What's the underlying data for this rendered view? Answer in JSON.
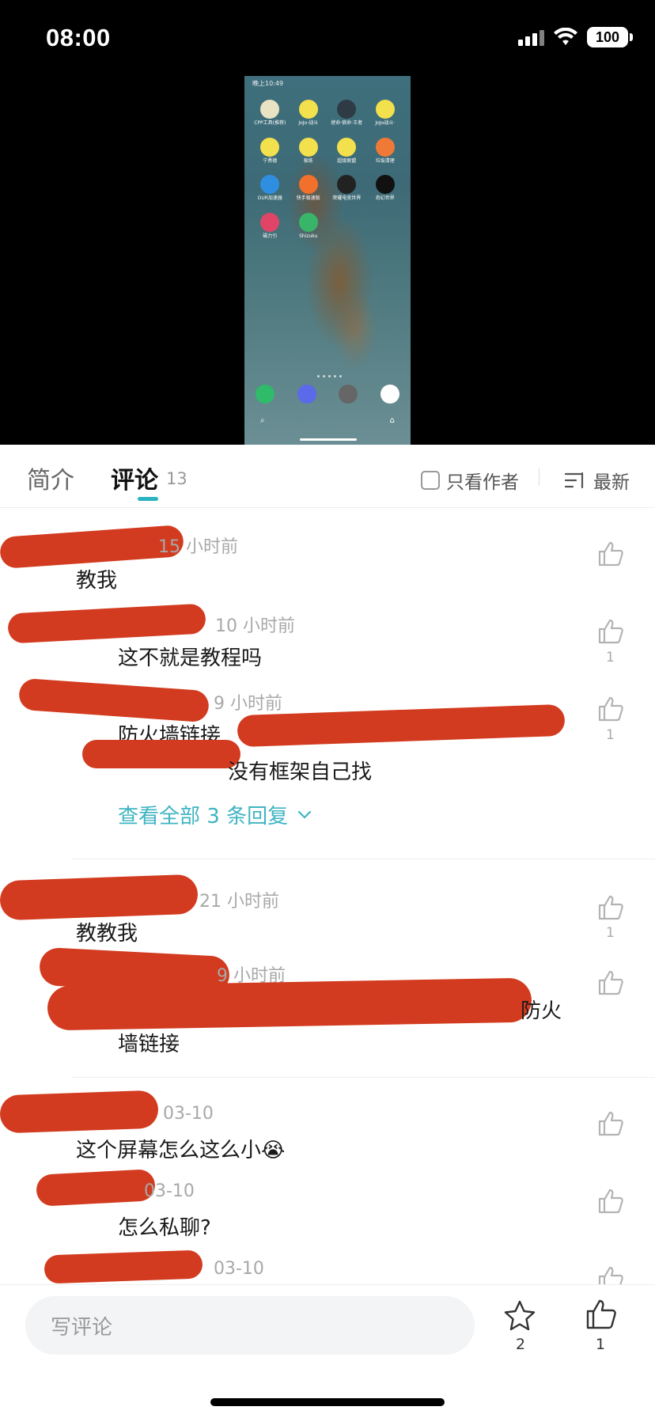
{
  "status_bar": {
    "time": "08:00",
    "battery": "100"
  },
  "video": {
    "status_text": "晚上10:49",
    "apps": [
      {
        "label": "CPP工具(推荐)",
        "color": "#e9e3c4"
      },
      {
        "label": "JoJo·战斗",
        "color": "#f3e04d"
      },
      {
        "label": "使命·宿命·王者",
        "color": "#2e3b45"
      },
      {
        "label": "JoJo战斗·",
        "color": "#f3e04d"
      },
      {
        "label": "宁勇德",
        "color": "#f3e04d"
      },
      {
        "label": "极练",
        "color": "#f3e04d"
      },
      {
        "label": "超级联盟",
        "color": "#f3e04d"
      },
      {
        "label": "垃圾清理",
        "color": "#ef7a37"
      },
      {
        "label": "OUR加速器",
        "color": "#2f8ee0"
      },
      {
        "label": "快手极速版",
        "color": "#f0702c"
      },
      {
        "label": "荣耀电竞世界",
        "color": "#222"
      },
      {
        "label": "奇幻世界",
        "color": "#111"
      },
      {
        "label": "磁力引",
        "color": "#e04567"
      },
      {
        "label": "Shizuku",
        "color": "#39b56a"
      }
    ],
    "dock_colors": [
      "#2fbb6a",
      "#5a6ae8",
      "#666",
      "#ffffff"
    ]
  },
  "tabs": {
    "intro": "简介",
    "comments": "评论",
    "comments_count": "13",
    "author_only": "只看作者",
    "sort": "最新"
  },
  "comments": [
    {
      "meta": "15 小时前",
      "text": "教我",
      "likes": ""
    },
    {
      "meta": "10 小时前",
      "text": "这不就是教程吗",
      "likes": "1"
    },
    {
      "meta": "9 小时前",
      "text": "防火墙链接",
      "text2": "没有框架自己找",
      "likes": "1"
    },
    {
      "meta": "21 小时前",
      "text": "教教我",
      "likes": "1"
    },
    {
      "meta": "9 小时前",
      "text": "防火",
      "text2": "墙链接",
      "likes": ""
    },
    {
      "meta": "03-10",
      "text": "这个屏幕怎么这么小😭",
      "likes": ""
    },
    {
      "meta": "03-10",
      "text": "怎么私聊?",
      "likes": ""
    },
    {
      "meta": "03-10",
      "text": "",
      "likes": ""
    }
  ],
  "view_all_replies": "查看全部 3 条回复",
  "bottom_bar": {
    "comment_placeholder": "写评论",
    "favorites": "2",
    "likes": "1"
  },
  "colors": {
    "accent": "#3fb4c2",
    "redaction": "#d23b1f"
  }
}
